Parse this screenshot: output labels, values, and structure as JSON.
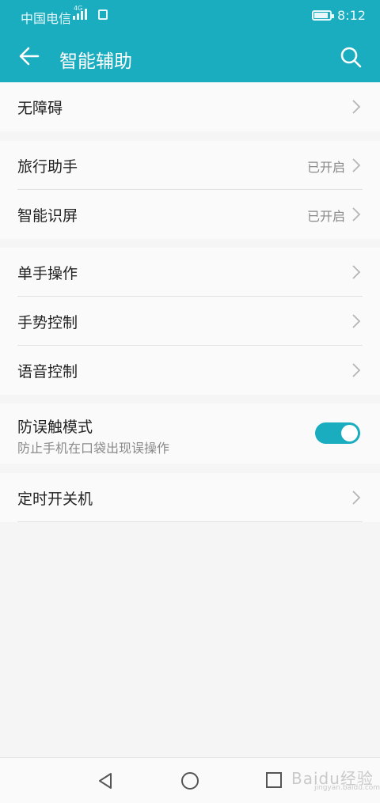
{
  "statusbar": {
    "carrier": "中国电信",
    "network": "4G",
    "time": "8:12"
  },
  "header": {
    "title": "智能辅助",
    "back_icon": "arrow-left-icon",
    "search_icon": "search-icon"
  },
  "sections": {
    "s1": {
      "accessibility": "无障碍"
    },
    "s2": {
      "travel_label": "旅行助手",
      "travel_value": "已开启",
      "smart_screen_label": "智能识屏",
      "smart_screen_value": "已开启"
    },
    "s3": {
      "one_hand": "单手操作",
      "gesture": "手势控制",
      "voice": "语音控制"
    },
    "s4": {
      "pocket_mode_label": "防误触模式",
      "pocket_mode_desc": "防止手机在口袋出现误操作",
      "pocket_mode_on": true
    },
    "s5": {
      "schedule_power": "定时开关机"
    }
  },
  "navbar": {
    "back": "triangle-back-icon",
    "home": "circle-home-icon",
    "recent": "square-recent-icon",
    "watermark": "Baidu经验",
    "watermark_sub": "jingyan.baidu.com"
  },
  "colors": {
    "accent": "#1aacbf",
    "background": "#f5f5f5",
    "card": "#fafafa"
  }
}
